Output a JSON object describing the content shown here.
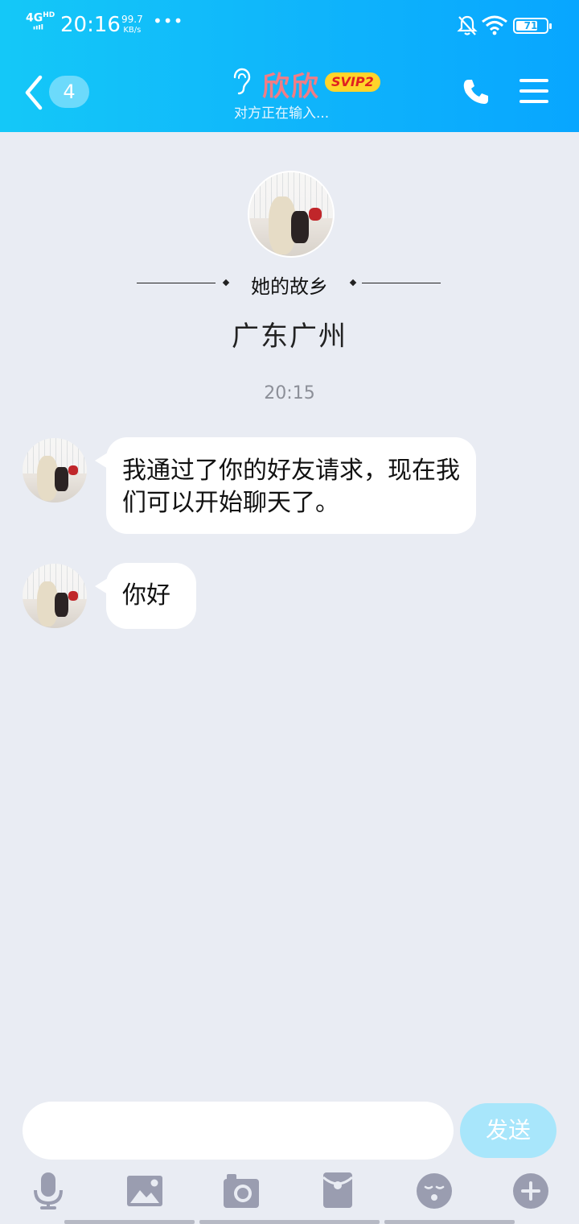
{
  "status_bar": {
    "network": "4G",
    "network_sup": "HD",
    "time": "20:16",
    "speed_value": "99.7",
    "speed_unit": "KB/s",
    "more": "•••",
    "battery": "71",
    "battery_level": 0.71
  },
  "header": {
    "unread_count": "4",
    "contact_name": "欣欣",
    "vip_badge": "SVIP2",
    "status": "对方正在输入..."
  },
  "profile": {
    "hometown_label": "她的故乡",
    "hometown_value": "广东广州"
  },
  "chat": {
    "timestamp": "20:15",
    "messages": [
      {
        "text": "我通过了你的好友请求，现在我们可以开始聊天了。"
      },
      {
        "text": "你好"
      }
    ]
  },
  "input": {
    "placeholder": "",
    "send_label": "发送"
  },
  "toolbar": {
    "items": [
      "microphone-icon",
      "image-icon",
      "camera-icon",
      "red-packet-icon",
      "emoji-icon",
      "plus-icon"
    ]
  },
  "colors": {
    "header_start": "#14c8f8",
    "header_end": "#08a6ff",
    "background": "#e9ecf3",
    "name": "#f07d86",
    "vip": "#ffd42a",
    "send_disabled": "#a8e6fb",
    "toolbar_icon": "#9a9db0"
  }
}
